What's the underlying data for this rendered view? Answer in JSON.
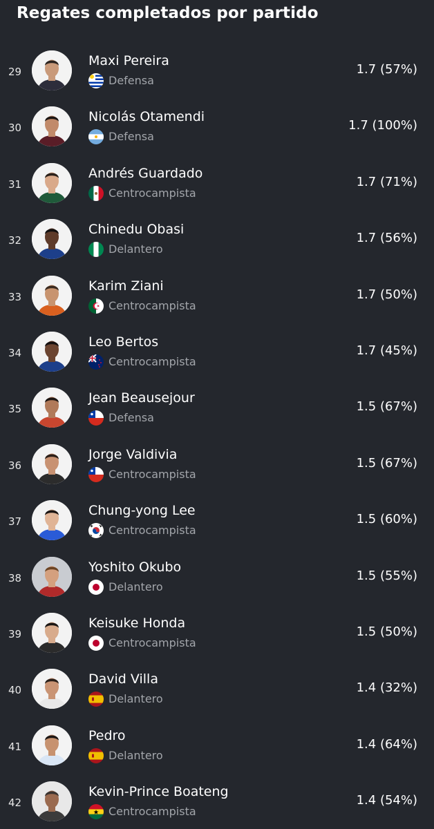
{
  "title": "Regates completados por partido",
  "players": [
    {
      "rank": "29",
      "name": "Maxi Pereira",
      "position": "Defensa",
      "country": "uruguay-flag-icon",
      "value": "1.7 (57%)"
    },
    {
      "rank": "30",
      "name": "Nicolás Otamendi",
      "position": "Defensa",
      "country": "argentina-flag-icon",
      "value": "1.7 (100%)"
    },
    {
      "rank": "31",
      "name": "Andrés Guardado",
      "position": "Centrocampista",
      "country": "mexico-flag-icon",
      "value": "1.7 (71%)"
    },
    {
      "rank": "32",
      "name": "Chinedu Obasi",
      "position": "Delantero",
      "country": "nigeria-flag-icon",
      "value": "1.7 (56%)"
    },
    {
      "rank": "33",
      "name": "Karim Ziani",
      "position": "Centrocampista",
      "country": "algeria-flag-icon",
      "value": "1.7 (50%)"
    },
    {
      "rank": "34",
      "name": "Leo Bertos",
      "position": "Centrocampista",
      "country": "new-zealand-flag-icon",
      "value": "1.7 (45%)"
    },
    {
      "rank": "35",
      "name": "Jean Beausejour",
      "position": "Defensa",
      "country": "chile-flag-icon",
      "value": "1.5 (67%)"
    },
    {
      "rank": "36",
      "name": "Jorge Valdivia",
      "position": "Centrocampista",
      "country": "chile-flag-icon",
      "value": "1.5 (67%)"
    },
    {
      "rank": "37",
      "name": "Chung-yong Lee",
      "position": "Centrocampista",
      "country": "south-korea-flag-icon",
      "value": "1.5 (60%)"
    },
    {
      "rank": "38",
      "name": "Yoshito Okubo",
      "position": "Delantero",
      "country": "japan-flag-icon",
      "value": "1.5 (55%)"
    },
    {
      "rank": "39",
      "name": "Keisuke Honda",
      "position": "Centrocampista",
      "country": "japan-flag-icon",
      "value": "1.5 (50%)"
    },
    {
      "rank": "40",
      "name": "David Villa",
      "position": "Delantero",
      "country": "spain-flag-icon",
      "value": "1.4 (32%)"
    },
    {
      "rank": "41",
      "name": "Pedro",
      "position": "Delantero",
      "country": "spain-flag-icon",
      "value": "1.4 (64%)"
    },
    {
      "rank": "42",
      "name": "Kevin-Prince Boateng",
      "position": "Centrocampista",
      "country": "ghana-flag-icon",
      "value": "1.4 (54%)"
    }
  ],
  "colors": {
    "background": "#24272d",
    "text": "#ffffff",
    "secondary_text": "#a3a6ab"
  }
}
